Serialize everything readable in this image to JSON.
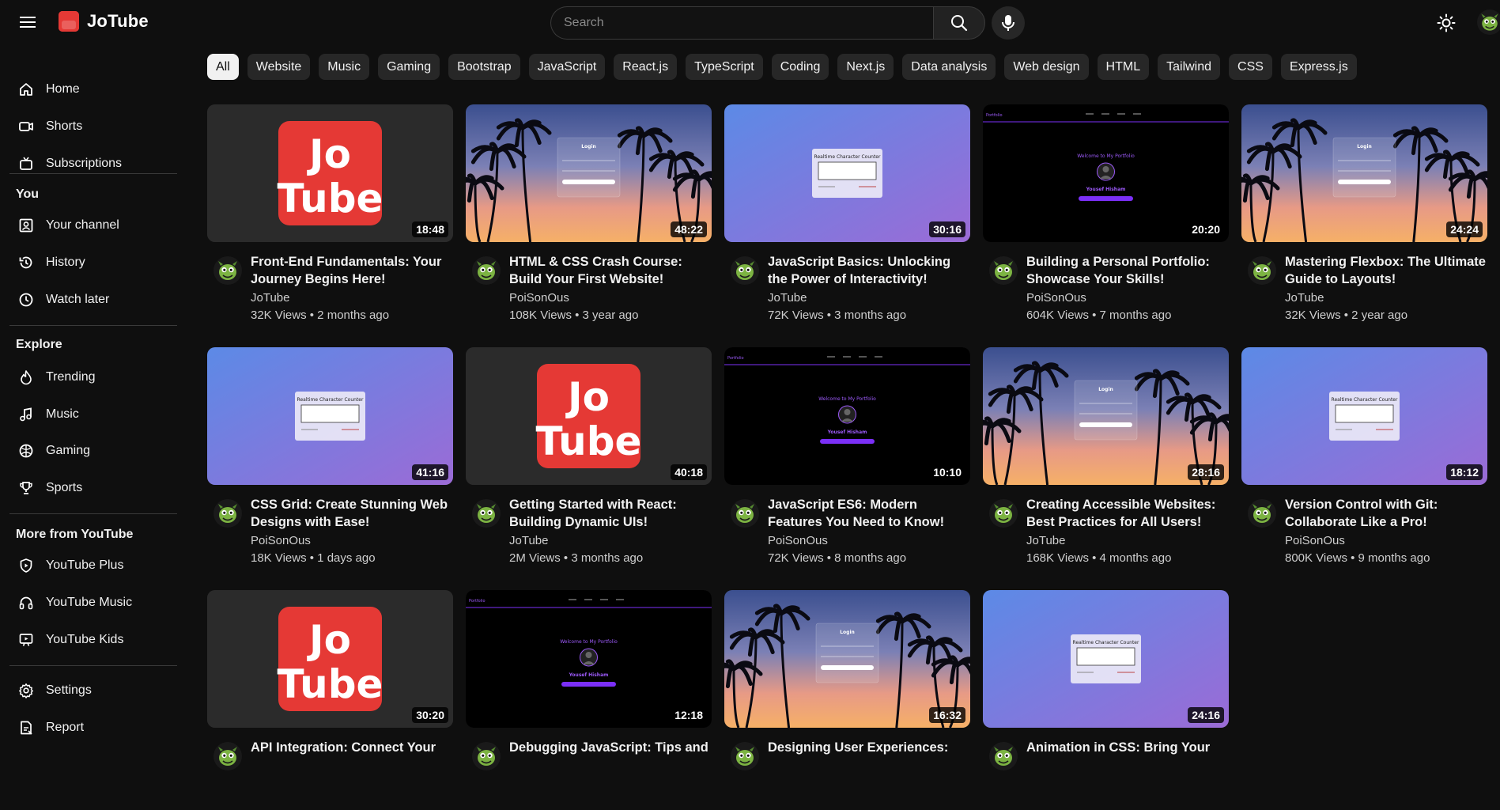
{
  "header": {
    "brand": "JoTube",
    "logo_text": "Jo\nTube",
    "search_placeholder": "Search"
  },
  "sidebar": {
    "main": [
      {
        "label": "Home",
        "icon": "home-icon"
      },
      {
        "label": "Shorts",
        "icon": "shorts-icon"
      },
      {
        "label": "Subscriptions",
        "icon": "subscriptions-icon"
      }
    ],
    "you_title": "You",
    "you": [
      {
        "label": "Your channel",
        "icon": "channel-icon"
      },
      {
        "label": "History",
        "icon": "history-icon"
      },
      {
        "label": "Watch later",
        "icon": "watch-later-icon"
      }
    ],
    "explore_title": "Explore",
    "explore": [
      {
        "label": "Trending",
        "icon": "trending-icon"
      },
      {
        "label": "Music",
        "icon": "music-icon"
      },
      {
        "label": "Gaming",
        "icon": "gaming-icon"
      },
      {
        "label": "Sports",
        "icon": "sports-icon"
      }
    ],
    "more_title": "More from YouTube",
    "more": [
      {
        "label": "YouTube Plus",
        "icon": "youtube-plus-icon"
      },
      {
        "label": "YouTube Music",
        "icon": "youtube-music-icon"
      },
      {
        "label": "YouTube Kids",
        "icon": "youtube-kids-icon"
      }
    ],
    "bottom": [
      {
        "label": "Settings",
        "icon": "settings-icon"
      },
      {
        "label": "Report",
        "icon": "report-icon"
      }
    ]
  },
  "chips": [
    "All",
    "Website",
    "Music",
    "Gaming",
    "Bootstrap",
    "JavaScript",
    "React.js",
    "TypeScript",
    "Coding",
    "Next.js",
    "Data analysis",
    "Web design",
    "HTML",
    "Tailwind",
    "CSS",
    "Express.js"
  ],
  "active_chip": "All",
  "thumb_text": {
    "login": "Login",
    "counter": "Realtime Character Counter",
    "portfolio_welcome": "Welcome to My Portfolio",
    "portfolio_name": "Yousef Hisham",
    "portfolio_brand": "Portfolio"
  },
  "videos": [
    {
      "title": "Front-End Fundamentals: Your Journey Begins Here!",
      "channel": "JoTube",
      "stats": "32K Views • 2 months ago",
      "duration": "18:48",
      "thumb": "logo"
    },
    {
      "title": "HTML & CSS Crash Course: Build Your First Website!",
      "channel": "PoiSonOus",
      "stats": "108K Views • 3 year ago",
      "duration": "48:22",
      "thumb": "palms"
    },
    {
      "title": "JavaScript Basics: Unlocking the Power of Interactivity!",
      "channel": "JoTube",
      "stats": "72K Views • 3 months ago",
      "duration": "30:16",
      "thumb": "counter"
    },
    {
      "title": "Building a Personal Portfolio: Showcase Your Skills!",
      "channel": "PoiSonOus",
      "stats": "604K Views • 7 months ago",
      "duration": "20:20",
      "thumb": "portfolio"
    },
    {
      "title": "Mastering Flexbox: The Ultimate Guide to Layouts!",
      "channel": "JoTube",
      "stats": "32K Views • 2 year ago",
      "duration": "24:24",
      "thumb": "palms"
    },
    {
      "title": "CSS Grid: Create Stunning Web Designs with Ease!",
      "channel": "PoiSonOus",
      "stats": "18K Views • 1 days ago",
      "duration": "41:16",
      "thumb": "counter"
    },
    {
      "title": "Getting Started with React: Building Dynamic UIs!",
      "channel": "JoTube",
      "stats": "2M Views • 3 months ago",
      "duration": "40:18",
      "thumb": "logo"
    },
    {
      "title": "JavaScript ES6: Modern Features You Need to Know!",
      "channel": "PoiSonOus",
      "stats": "72K Views • 8 months ago",
      "duration": "10:10",
      "thumb": "portfolio"
    },
    {
      "title": "Creating Accessible Websites: Best Practices for All Users!",
      "channel": "JoTube",
      "stats": "168K Views • 4 months ago",
      "duration": "28:16",
      "thumb": "palms"
    },
    {
      "title": "Version Control with Git: Collaborate Like a Pro!",
      "channel": "PoiSonOus",
      "stats": "800K Views • 9 months ago",
      "duration": "18:12",
      "thumb": "counter"
    },
    {
      "title": "API Integration: Connect Your",
      "channel": "",
      "stats": "",
      "duration": "30:20",
      "thumb": "logo"
    },
    {
      "title": "Debugging JavaScript: Tips and",
      "channel": "",
      "stats": "",
      "duration": "12:18",
      "thumb": "portfolio"
    },
    {
      "title": "Designing User Experiences:",
      "channel": "",
      "stats": "",
      "duration": "16:32",
      "thumb": "palms"
    },
    {
      "title": "Animation in CSS: Bring Your",
      "channel": "",
      "stats": "",
      "duration": "24:16",
      "thumb": "counter"
    }
  ],
  "colors": {
    "background": "#0f0f0f",
    "chip": "#272727",
    "chip_active": "#f1f1f1",
    "logo_red": "#e53935",
    "accent_purple": "#7b2ff7"
  }
}
